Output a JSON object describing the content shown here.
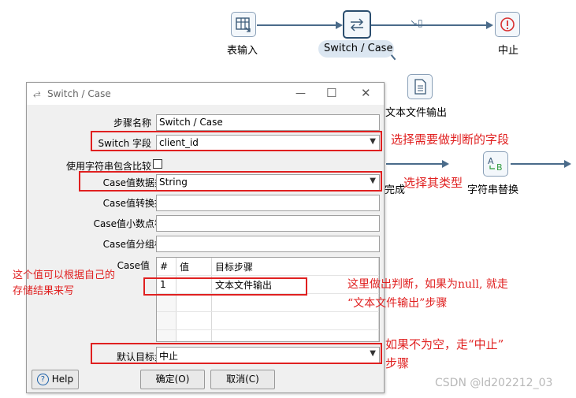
{
  "canvas": {
    "nodes": {
      "table_input": {
        "label": "表输入",
        "icon": "table-icon"
      },
      "switch_case": {
        "label": "Switch / Case",
        "icon": "switch-arrows-icon"
      },
      "abort": {
        "label": "中止",
        "icon": "abort-icon"
      },
      "text_output": {
        "label": "文本文件输出",
        "icon": "text-file-icon"
      },
      "string_replace": {
        "label": "字符串替换",
        "icon": "ab-replace-icon"
      }
    },
    "partial_label": "完成"
  },
  "dialog": {
    "title": "Switch / Case",
    "step_name_label": "步骤名称",
    "step_name_value": "Switch / Case",
    "switch_field_label": "Switch 字段",
    "switch_field_value": "client_id",
    "use_contains_label": "使用字符串包含比较",
    "case_type_label": "Case值数据类型",
    "case_type_value": "String",
    "conversion_mask_label": "Case值转换掩码",
    "decimal_symbol_label": "Case值小数点符号",
    "grouping_symbol_label": "Case值分组标志",
    "case_values_label": "Case值",
    "table_headers": [
      "#",
      "值",
      "目标步骤"
    ],
    "rows": [
      {
        "num": "1",
        "value": "",
        "target": "文本文件输出"
      }
    ],
    "default_target_label": "默认目标步骤",
    "default_target_value": "中止",
    "help_label": "Help",
    "ok_label": "确定(O)",
    "cancel_label": "取消(C)"
  },
  "annotations": {
    "switch_field": "选择需要做判断的字段",
    "case_type": "选择其类型",
    "case_value_note_1": "这个值可以根据自己的",
    "case_value_note_2": "存储结果来写",
    "judge_note_1": "这里做出判断，如果为null, 就走",
    "judge_note_2": "“文本文件输出”步骤",
    "default_note_1": "如果不为空，走“中止”",
    "default_note_2": "步骤"
  },
  "watermark": "CSDN @ld202212_03",
  "colors": {
    "annotation_red": "#e02020",
    "hop_line": "#4a6b8a",
    "abort_red": "#d93030",
    "replace_green": "#2e9b3e"
  }
}
